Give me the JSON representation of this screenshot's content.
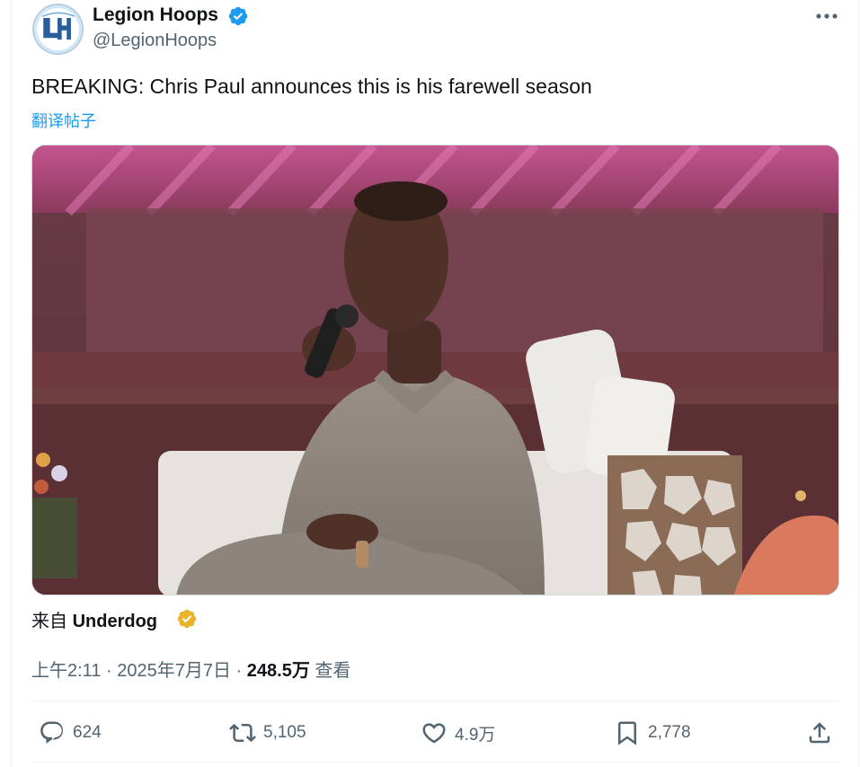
{
  "author": {
    "display_name": "Legion Hoops",
    "handle": "@LegionHoops",
    "avatar_monogram": "LH",
    "verified_color": "#1d9bf0"
  },
  "post": {
    "text": "BREAKING: Chris Paul announces this is his farewell season",
    "translate_label": "翻译帖子"
  },
  "media": {
    "type": "video-still",
    "description_icon": "video-frame"
  },
  "source": {
    "prefix": "来自 ",
    "name": "Underdog",
    "badge_color": "#e8b429"
  },
  "meta": {
    "time": "上午2:11",
    "sep1": " · ",
    "date": "2025年7月7日",
    "sep2": " · ",
    "views": "248.5万",
    "views_label": " 查看"
  },
  "actions": {
    "replies": "624",
    "retweets": "5,105",
    "likes": "4.9万",
    "bookmarks": "2,778"
  },
  "colors": {
    "text_primary": "#0f1419",
    "text_secondary": "#536471",
    "link": "#1d9bf0"
  }
}
